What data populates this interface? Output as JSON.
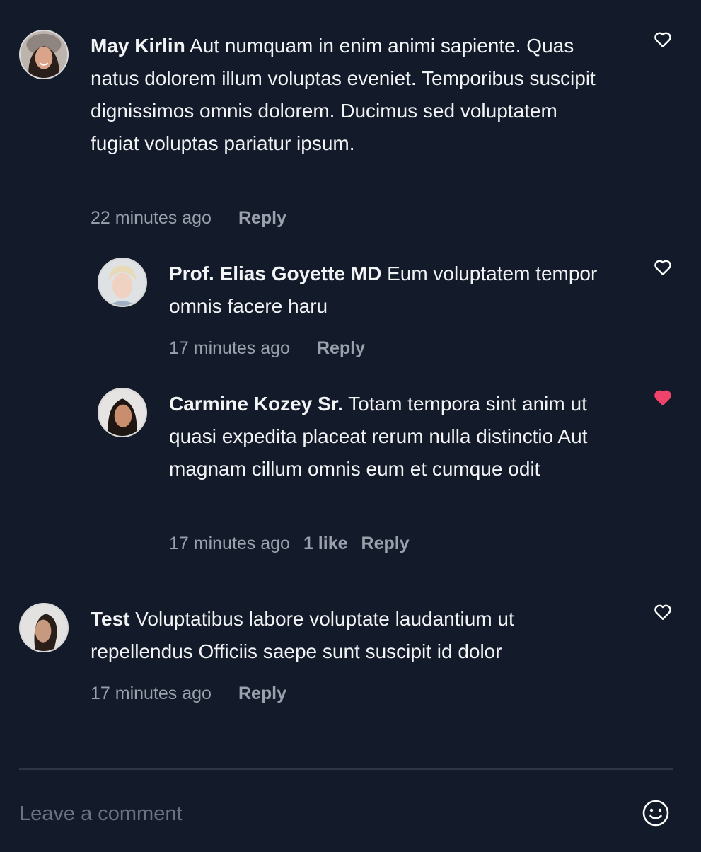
{
  "comments": [
    {
      "author": "May Kirlin",
      "text": "Aut numquam in enim animi sapiente. Quas natus dolorem illum voluptas eveniet. Temporibus suscipit dignissimos omnis dolorem. Ducimus sed voluptatem fugiat voluptas pariatur ipsum.",
      "time": "22 minutes ago",
      "likes": "",
      "reply_label": "Reply",
      "liked": false,
      "icon": "heart-outline-icon"
    },
    {
      "author": "Prof. Elias Goyette MD",
      "text": "Eum voluptatem tempor omnis facere haru",
      "time": "17 minutes ago",
      "likes": "",
      "reply_label": "Reply",
      "liked": false,
      "icon": "heart-outline-icon"
    },
    {
      "author": "Carmine Kozey Sr.",
      "text": "Totam tempora sint anim ut quasi expedita placeat rerum nulla distinctio Aut magnam cillum omnis eum et cumque odit",
      "time": "17 minutes ago",
      "likes": "1 like",
      "reply_label": "Reply",
      "liked": true,
      "icon": "heart-filled-icon"
    },
    {
      "author": "Test",
      "text": "Voluptatibus labore voluptate laudantium ut repellendus Officiis saepe sunt suscipit id dolor",
      "time": "17 minutes ago",
      "likes": "",
      "reply_label": "Reply",
      "liked": false,
      "icon": "heart-outline-icon"
    }
  ],
  "composer": {
    "placeholder": "Leave a comment",
    "value": "",
    "emoji_icon": "smiley-icon"
  },
  "colors": {
    "background": "#131a29",
    "like_active": "#f0436a",
    "muted_text": "#9aa1ad"
  }
}
